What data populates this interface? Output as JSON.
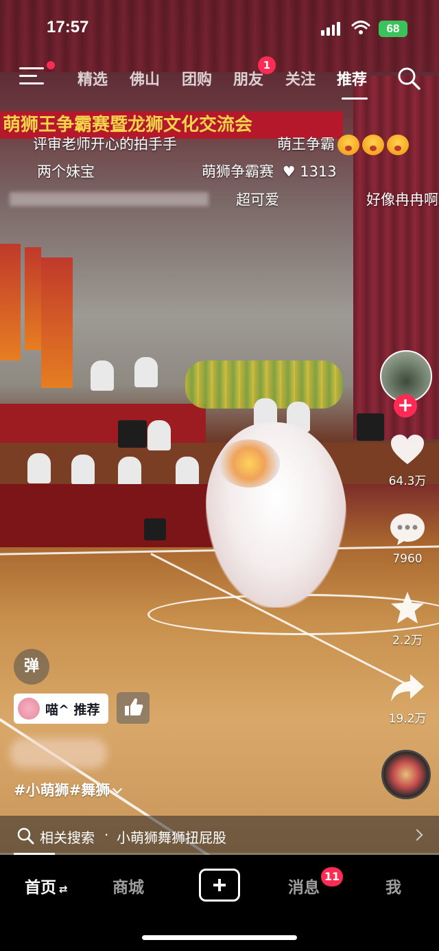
{
  "status_bar": {
    "time": "17:57",
    "battery": "68"
  },
  "top_nav": {
    "tabs": [
      {
        "label": "精选"
      },
      {
        "label": "佛山"
      },
      {
        "label": "团购"
      },
      {
        "label": "朋友"
      },
      {
        "label": "关注"
      },
      {
        "label": "推荐"
      }
    ],
    "friend_badge": "1",
    "active_tab": "推荐"
  },
  "video": {
    "banner_text": "萌狮王争霸赛暨龙狮文化交流会"
  },
  "danmaku": [
    {
      "text": "评审老师开心的拍手手"
    },
    {
      "text": "萌王争霸"
    },
    {
      "text": "两个妹宝"
    },
    {
      "text": "萌狮争霸赛"
    },
    {
      "text": "1313"
    },
    {
      "text": "超可爱"
    },
    {
      "text": "好像冉冉啊"
    }
  ],
  "actions": {
    "likes": "64.3万",
    "comments": "7960",
    "favorites": "2.2万",
    "shares": "19.2万"
  },
  "info": {
    "danmu_toggle": "弹",
    "recommend_label": "喵^ 推荐",
    "hashtags": "#小萌狮#舞狮"
  },
  "related_search": {
    "label": "相关搜索",
    "separator": "·",
    "query": "小萌狮舞狮扭屁股"
  },
  "playback": {
    "progress": 0.1
  },
  "tab_bar": {
    "home": "首页",
    "home_refresh": "⇄",
    "mall": "商城",
    "messages": "消息",
    "messages_badge": "11",
    "me": "我"
  },
  "colors": {
    "accent": "#fe2c55",
    "battery": "#3ac35a"
  }
}
